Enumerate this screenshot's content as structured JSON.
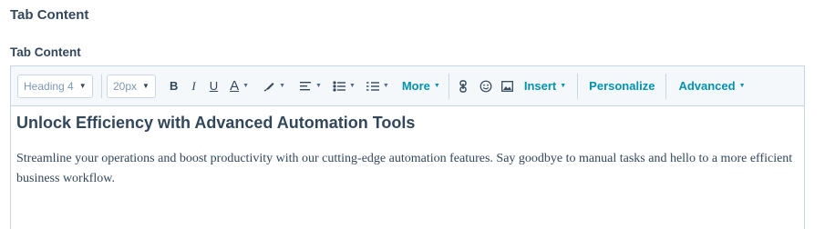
{
  "section_title": "Tab Content",
  "field_label": "Tab Content",
  "toolbar": {
    "block_format": "Heading 4",
    "font_size": "20px",
    "bold": "B",
    "italic": "I",
    "underline": "U",
    "text_color": "A",
    "more_label": "More",
    "insert_label": "Insert",
    "personalize_label": "Personalize",
    "advanced_label": "Advanced"
  },
  "content": {
    "heading": "Unlock Efficiency with Advanced Automation Tools",
    "paragraph": "Streamline your operations and boost productivity with our cutting-edge automation features. Say goodbye to manual tasks and hello to a more efficient business workflow."
  },
  "colors": {
    "link": "#0091ae",
    "text": "#33475b",
    "border": "#cbd6e2",
    "toolbar_bg": "#f5f8fa"
  },
  "icons": [
    "highlight-icon",
    "align-icon",
    "bulleted-list-icon",
    "numbered-list-icon",
    "link-icon",
    "emoji-icon",
    "image-icon"
  ]
}
